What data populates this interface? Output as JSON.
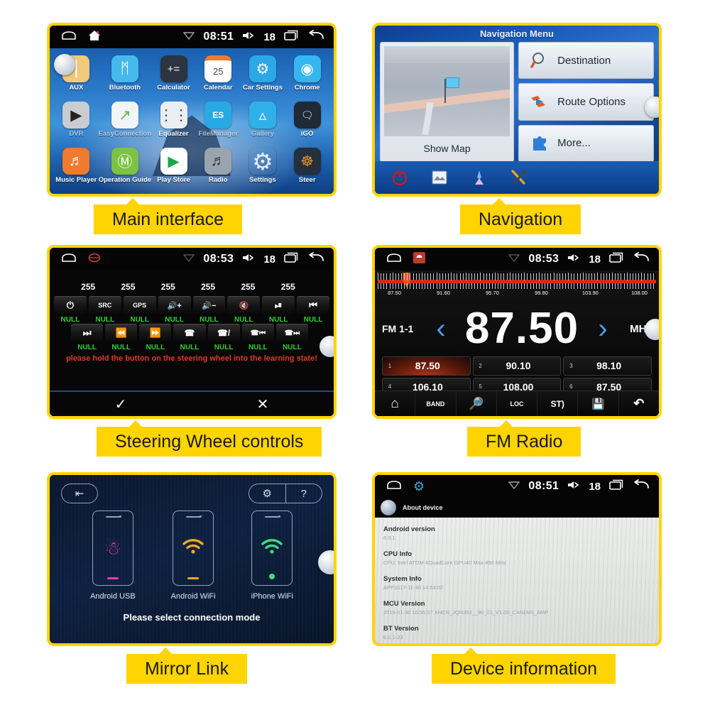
{
  "panels": {
    "main": {
      "caption": "Main interface",
      "status": {
        "time": "08:51",
        "volume": "18",
        "home_icon": "home-icon",
        "launcher_icon": "house-icon",
        "wifi_icon": "wifi-icon",
        "speaker_icon": "speaker-icon",
        "recents_icon": "recents-icon",
        "back_icon": "back-icon"
      },
      "apps": [
        {
          "name": "AUX",
          "icon": "aux-icon",
          "glyph": "‖",
          "bg": "#f0c97a",
          "dim": false
        },
        {
          "name": "Bluetooth",
          "icon": "bluetooth-icon",
          "glyph": "ᛗ",
          "bg": "#46b9ec",
          "dim": false
        },
        {
          "name": "Calculator",
          "icon": "calculator-icon",
          "glyph": "÷",
          "bg": "#2b3440",
          "dim": false
        },
        {
          "name": "Calendar",
          "icon": "calendar-icon",
          "glyph": "25",
          "bg": "#ffffff",
          "dim": false
        },
        {
          "name": "Car Settings",
          "icon": "car-settings-icon",
          "glyph": "⚙",
          "bg": "#2ba8e8",
          "dim": false
        },
        {
          "name": "Chrome",
          "icon": "chrome-icon",
          "glyph": "◉",
          "bg": "#35b6f0",
          "dim": false
        },
        {
          "name": "DVR",
          "icon": "dvr-icon",
          "glyph": "▶",
          "bg": "#c9ccd1",
          "dim": true
        },
        {
          "name": "EasyConnection",
          "icon": "easyconnection-icon",
          "glyph": "↗",
          "bg": "#f2f4f6",
          "dim": true
        },
        {
          "name": "Equalizer",
          "icon": "equalizer-icon",
          "glyph": "↕",
          "bg": "#eceff2",
          "dim": false
        },
        {
          "name": "FileManager",
          "icon": "filemanager-icon",
          "glyph": "ES",
          "bg": "#29a9e4",
          "dim": true
        },
        {
          "name": "Gallery",
          "icon": "gallery-icon",
          "glyph": "△",
          "bg": "#2fb0e8",
          "dim": true
        },
        {
          "name": "iGO",
          "icon": "igo-icon",
          "glyph": "▤",
          "bg": "#1f2a36",
          "dim": false
        },
        {
          "name": "Music Player",
          "icon": "music-player-icon",
          "glyph": "♪",
          "bg": "#f07a2e",
          "dim": false
        },
        {
          "name": "Operation Guide",
          "icon": "operation-guide-icon",
          "glyph": "Ⓐ",
          "bg": "#7dc242",
          "dim": false
        },
        {
          "name": "Play Store",
          "icon": "play-store-icon",
          "glyph": "▶",
          "bg": "#ffffff",
          "dim": false
        },
        {
          "name": "Radio",
          "icon": "radio-icon",
          "glyph": "♬",
          "bg": "#9aa4ae",
          "dim": false
        },
        {
          "name": "Settings",
          "icon": "settings-icon",
          "glyph": "⚙",
          "bg": "#7d8893",
          "dim": false
        },
        {
          "name": "Steer",
          "icon": "steer-icon",
          "glyph": "☸",
          "bg": "#23303d",
          "dim": false
        }
      ]
    },
    "navigation": {
      "caption": "Navigation",
      "title": "Navigation Menu",
      "map_label": "Show Map",
      "buttons": [
        {
          "label": "Destination",
          "icon": "magnifier-icon",
          "glyph": "🔍"
        },
        {
          "label": "Route Options",
          "icon": "route-icon",
          "glyph": "➤"
        },
        {
          "label": "More...",
          "icon": "puzzle-icon",
          "glyph": "🧩"
        }
      ],
      "toolbar": [
        {
          "icon": "power-icon",
          "glyph": "⏻"
        },
        {
          "icon": "map-icon",
          "glyph": "🗺"
        },
        {
          "icon": "vehicle-icon",
          "glyph": "♟"
        },
        {
          "icon": "tools-icon",
          "glyph": "⚒"
        }
      ]
    },
    "steering": {
      "caption": "Steering Wheel controls",
      "status": {
        "time": "08:53",
        "volume": "18"
      },
      "values": [
        "255",
        "255",
        "255",
        "255",
        "255",
        "255"
      ],
      "row1": [
        {
          "icon": "power-icon",
          "glyph": "⏻",
          "label": "NULL"
        },
        {
          "icon": "src-icon",
          "glyph": "SRC",
          "label": "NULL"
        },
        {
          "icon": "gps-icon",
          "glyph": "GPS",
          "label": "NULL"
        },
        {
          "icon": "volume-up-icon",
          "glyph": "🔊+",
          "label": "NULL"
        },
        {
          "icon": "volume-down-icon",
          "glyph": "🔊−",
          "label": "NULL"
        },
        {
          "icon": "mute-icon",
          "glyph": "🔇",
          "label": "NULL"
        },
        {
          "icon": "play-pause-icon",
          "glyph": "⏯",
          "label": "NULL"
        },
        {
          "icon": "previous-icon",
          "glyph": "⏮",
          "label": "NULL"
        }
      ],
      "row2": [
        {
          "icon": "next-icon",
          "glyph": "⏭",
          "label": "NULL"
        },
        {
          "icon": "rewind-icon",
          "glyph": "⏪",
          "label": "NULL"
        },
        {
          "icon": "fast-forward-icon",
          "glyph": "⏩",
          "label": "NULL"
        },
        {
          "icon": "call-icon",
          "glyph": "✆",
          "label": "NULL"
        },
        {
          "icon": "hangup-icon",
          "glyph": "✆",
          "label": "NULL"
        },
        {
          "icon": "call-prev-icon",
          "glyph": "✆",
          "label": "NULL"
        },
        {
          "icon": "call-next-icon",
          "glyph": "✆",
          "label": "NULL"
        }
      ],
      "hint": "please hold the button on the steering wheel into the learning state!",
      "confirm_icon": "✓",
      "cancel_icon": "✕"
    },
    "fm": {
      "caption": "FM Radio",
      "status": {
        "time": "08:53",
        "volume": "18"
      },
      "scale_labels": [
        "87.50",
        "91.60",
        "95.70",
        "99.80",
        "103.90",
        "108.00"
      ],
      "band": "FM 1-1",
      "frequency": "87.50",
      "unit": "MHz",
      "prev_icon": "‹",
      "next_icon": "›",
      "presets": [
        {
          "index": "1",
          "freq": "87.50",
          "active": true
        },
        {
          "index": "2",
          "freq": "90.10",
          "active": false
        },
        {
          "index": "3",
          "freq": "98.10",
          "active": false
        },
        {
          "index": "4",
          "freq": "106.10",
          "active": false
        },
        {
          "index": "5",
          "freq": "108.00",
          "active": false
        },
        {
          "index": "6",
          "freq": "87.50",
          "active": false
        }
      ],
      "toolbar": [
        {
          "icon": "home-icon",
          "glyph": "⌂"
        },
        {
          "icon": "band-icon",
          "glyph": "BAND"
        },
        {
          "icon": "scan-icon",
          "glyph": "🔎"
        },
        {
          "icon": "loc-icon",
          "glyph": "LOC"
        },
        {
          "icon": "stereo-icon",
          "glyph": "ST)"
        },
        {
          "icon": "save-icon",
          "glyph": "💾"
        },
        {
          "icon": "back-icon",
          "glyph": "↶"
        }
      ]
    },
    "mirror": {
      "caption": "Mirror Link",
      "exit_icon": "exit-icon",
      "exit_glyph": "⇤",
      "gear_icon": "gear-icon",
      "gear_glyph": "⚙",
      "help_icon": "help-icon",
      "help_glyph": "?",
      "modes": [
        {
          "label": "Android USB",
          "icon": "usb-icon",
          "glyph": "ᚠ",
          "color": "#ef3ab2"
        },
        {
          "label": "Android WiFi",
          "icon": "wifi-icon",
          "glyph": "▲",
          "color": "#f5a623"
        },
        {
          "label": "iPhone WiFi",
          "icon": "wifi-icon",
          "glyph": "▲",
          "color": "#3ddc84"
        }
      ],
      "hint": "Please select connection mode"
    },
    "device": {
      "caption": "Device information",
      "status": {
        "time": "08:51",
        "volume": "18"
      },
      "header": "About device",
      "settings_icon": "gear-icon",
      "items": [
        {
          "key": "Android version",
          "value": "6.0.1"
        },
        {
          "key": "CPU Info",
          "value": "CPU: Intel ATOM 4QuadCore  GPU40  Max-450 MHz"
        },
        {
          "key": "System Info",
          "value": "APP2017-11-30 14:53:02"
        },
        {
          "key": "MCU Version",
          "value": "2019-01-30 10:55:57 XHCN_JQN353__90_01_V1.00_CAN(A6)_AMP"
        },
        {
          "key": "BT Version",
          "value": "6.0.1-23"
        }
      ]
    }
  },
  "colors": {
    "accent": "#FFD400",
    "green": "#2fd02f",
    "red": "#e03a2f",
    "blue": "#1b5fae"
  }
}
